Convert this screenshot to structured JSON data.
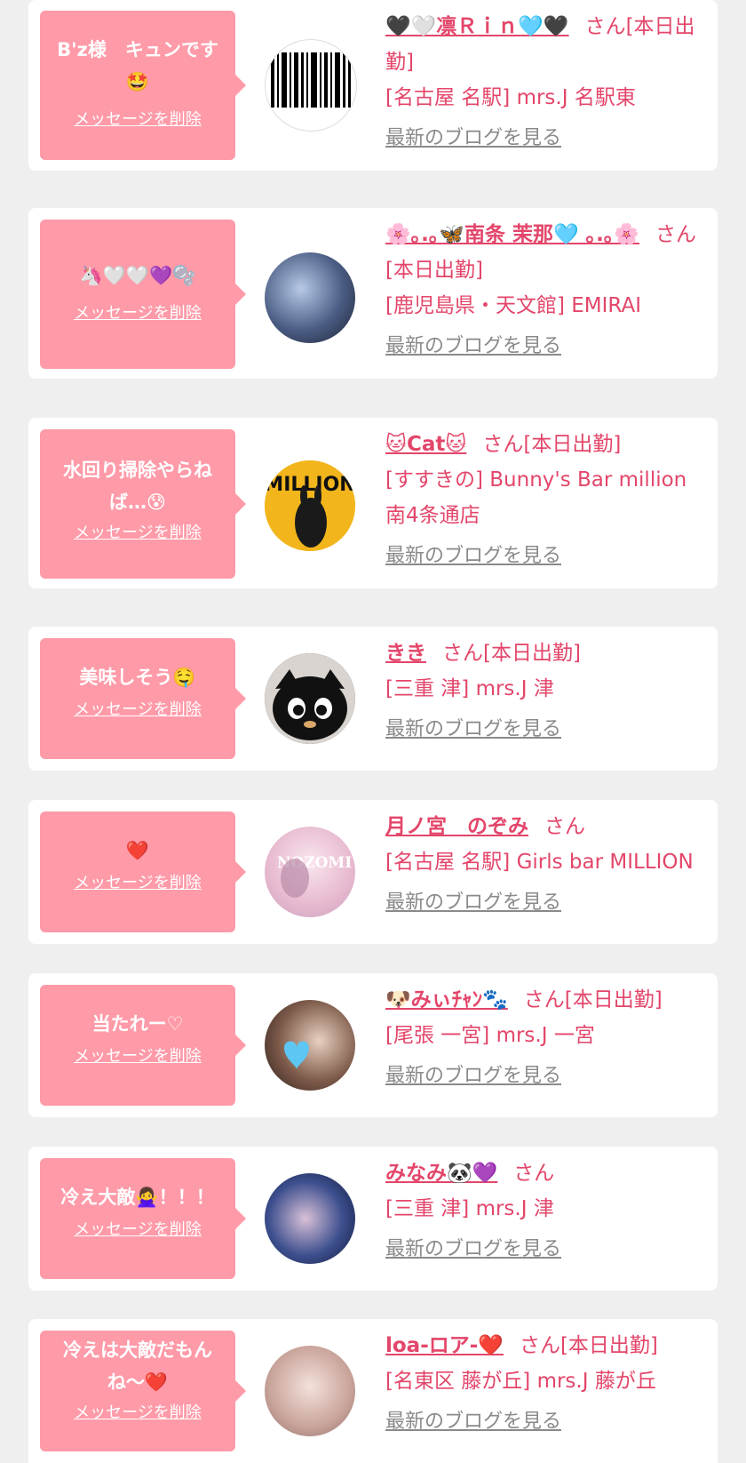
{
  "delete_label": "メッセージを削除",
  "blog_label": "最新のブログを見る",
  "san_label": "さん",
  "accent_color": "#e3466a",
  "bubble_color": "#ff9aa8",
  "cards": [
    {
      "message": "B'z様　キュンです🤩",
      "name": "🖤🤍凛Ｒｉｎ🩵🖤",
      "suffix": "さん[本日出勤]",
      "shop": "[名古屋 名駅] mrs.J 名駅東",
      "avatar": "barcode-avatar"
    },
    {
      "message": "🦄🤍🤍💜🫧",
      "name": "🌸｡.｡🦋南条 茉那🩵 ｡.｡🌸",
      "suffix": "さん[本日出勤]",
      "shop": "[鹿児島県・天文館] EMIRAI",
      "avatar": "photo-avatar"
    },
    {
      "message": "水回り掃除やらねば…😰",
      "name": "🐱Cat🐱",
      "suffix": "さん[本日出勤]",
      "shop": "[すすきの] Bunny's Bar million 南4条通店",
      "avatar": "cat-magazine-avatar"
    },
    {
      "message": "美味しそう🤤",
      "name": "きき",
      "suffix": "さん[本日出勤]",
      "shop": "[三重 津] mrs.J 津",
      "avatar": "black-cat-avatar"
    },
    {
      "message": "❤️",
      "name": "月ノ宮　のぞみ",
      "suffix": "さん",
      "shop": "[名古屋 名駅] Girls bar MILLION",
      "avatar": "nozomi-avatar"
    },
    {
      "message": "当たれー♡",
      "name": "🐶みぃﾁｬﾝ🐾",
      "suffix": "さん[本日出勤]",
      "shop": "[尾張 一宮] mrs.J 一宮",
      "avatar": "selfie-avatar"
    },
    {
      "message": "冷え大敵🙅‍♀️！！！",
      "name": "みなみ🐼💜",
      "suffix": "さん",
      "shop": "[三重 津] mrs.J 津",
      "avatar": "night-avatar"
    },
    {
      "message": "冷えは大敵だもんね〜❤️",
      "name": "loa-ロア-❤️",
      "suffix": "さん[本日出勤]",
      "shop": "[名東区 藤が丘] mrs.J 藤が丘",
      "avatar": "portrait-avatar"
    }
  ]
}
